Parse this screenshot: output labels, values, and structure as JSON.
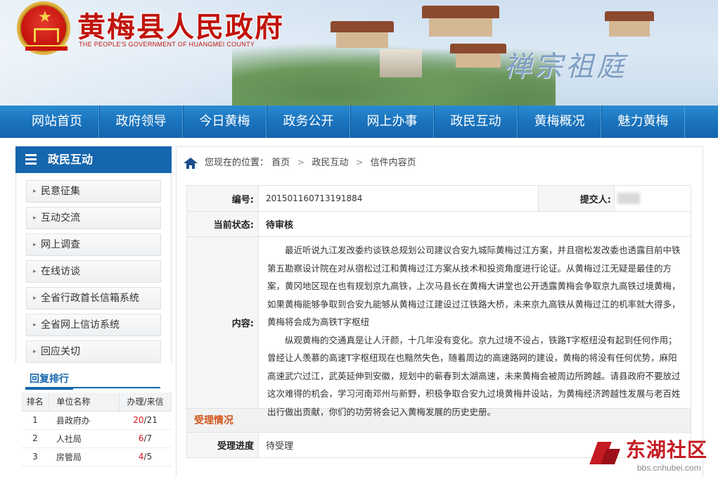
{
  "header": {
    "title": "黄梅县人民政府",
    "subtitle": "THE PEOPLE'S GOVERNMENT OF HUANGMEI COUNTY",
    "slogan": "禅宗祖庭"
  },
  "nav": {
    "items": [
      "网站首页",
      "政府领导",
      "今日黄梅",
      "政务公开",
      "网上办事",
      "政民互动",
      "黄梅概况",
      "魅力黄梅"
    ]
  },
  "sidebar": {
    "title": "政民互动",
    "items": [
      "民意征集",
      "互动交流",
      "网上调查",
      "在线访谈",
      "全省行政首长信箱系统",
      "全省网上信访系统",
      "回应关切"
    ],
    "ranking": {
      "title": "回复排行",
      "headers": [
        "排名",
        "单位名称",
        "办理/来信"
      ],
      "rows": [
        {
          "rank": "1",
          "unit": "县政府办",
          "handled": "20",
          "total": "21"
        },
        {
          "rank": "2",
          "unit": "人社局",
          "handled": "6",
          "total": "7"
        },
        {
          "rank": "3",
          "unit": "房管局",
          "handled": "4",
          "total": "5"
        }
      ]
    }
  },
  "breadcrumb": {
    "prefix": "您现在的位置：",
    "items": [
      "首页",
      "政民互动",
      "信件内容页"
    ]
  },
  "letter": {
    "id_label": "编号:",
    "id_value": "201501160713191884",
    "submitter_label": "提交人:",
    "status_label": "当前状态:",
    "status_value": "待审核",
    "content_label": "内容:",
    "paragraphs": [
      "最近听说九江发改委约谈铁总规划公司建议合安九城际黄梅过江方案，并且宿松发改委也透露目前中铁第五勘察设计院在对从宿松过江和黄梅过江方案从技术和投资角度进行论证。从黄梅过江无疑是最佳的方案，黄冈地区现在也有规划京九高铁，上次马县长在黄梅大讲堂也公开透露黄梅会争取京九高铁过境黄梅，如果黄梅能够争取到合安九能够从黄梅过江建设过江铁路大桥，未来京九高铁从黄梅过江的机率就大得多，黄梅将会成为高铁T字枢纽",
      "纵观黄梅的交通真是让人汗颜，十几年没有变化。京九过境不设占，铁路T字枢纽没有起到任何作用；曾经让人羡慕的高速T字枢纽现在也黯然失色，随着周边的高速路网的建设，黄梅的将没有任何优势，麻阳高速武穴过江，武英延伸到安徽，规划中的蕲春到太湖高速，未来黄梅会被周边所跨越。请县政府不要放过这次难得的机会，学习河南邓州与新野，积极争取合安九过境黄梅并设站，为黄梅经济跨越性发展与老百姓出行做出贡献，你们的功劳将会记入黄梅发展的历史史册。"
    ],
    "section_title": "受理情况",
    "progress_label": "受理进度",
    "progress_value": "待受理"
  },
  "watermark": {
    "name": "东湖社区",
    "url": "bbs.cnhubei.com"
  },
  "colors": {
    "nav_blue": "#1a73bd",
    "title_red": "#c0140c",
    "rank_red": "#d4141c",
    "section_orange": "#d2541a"
  }
}
